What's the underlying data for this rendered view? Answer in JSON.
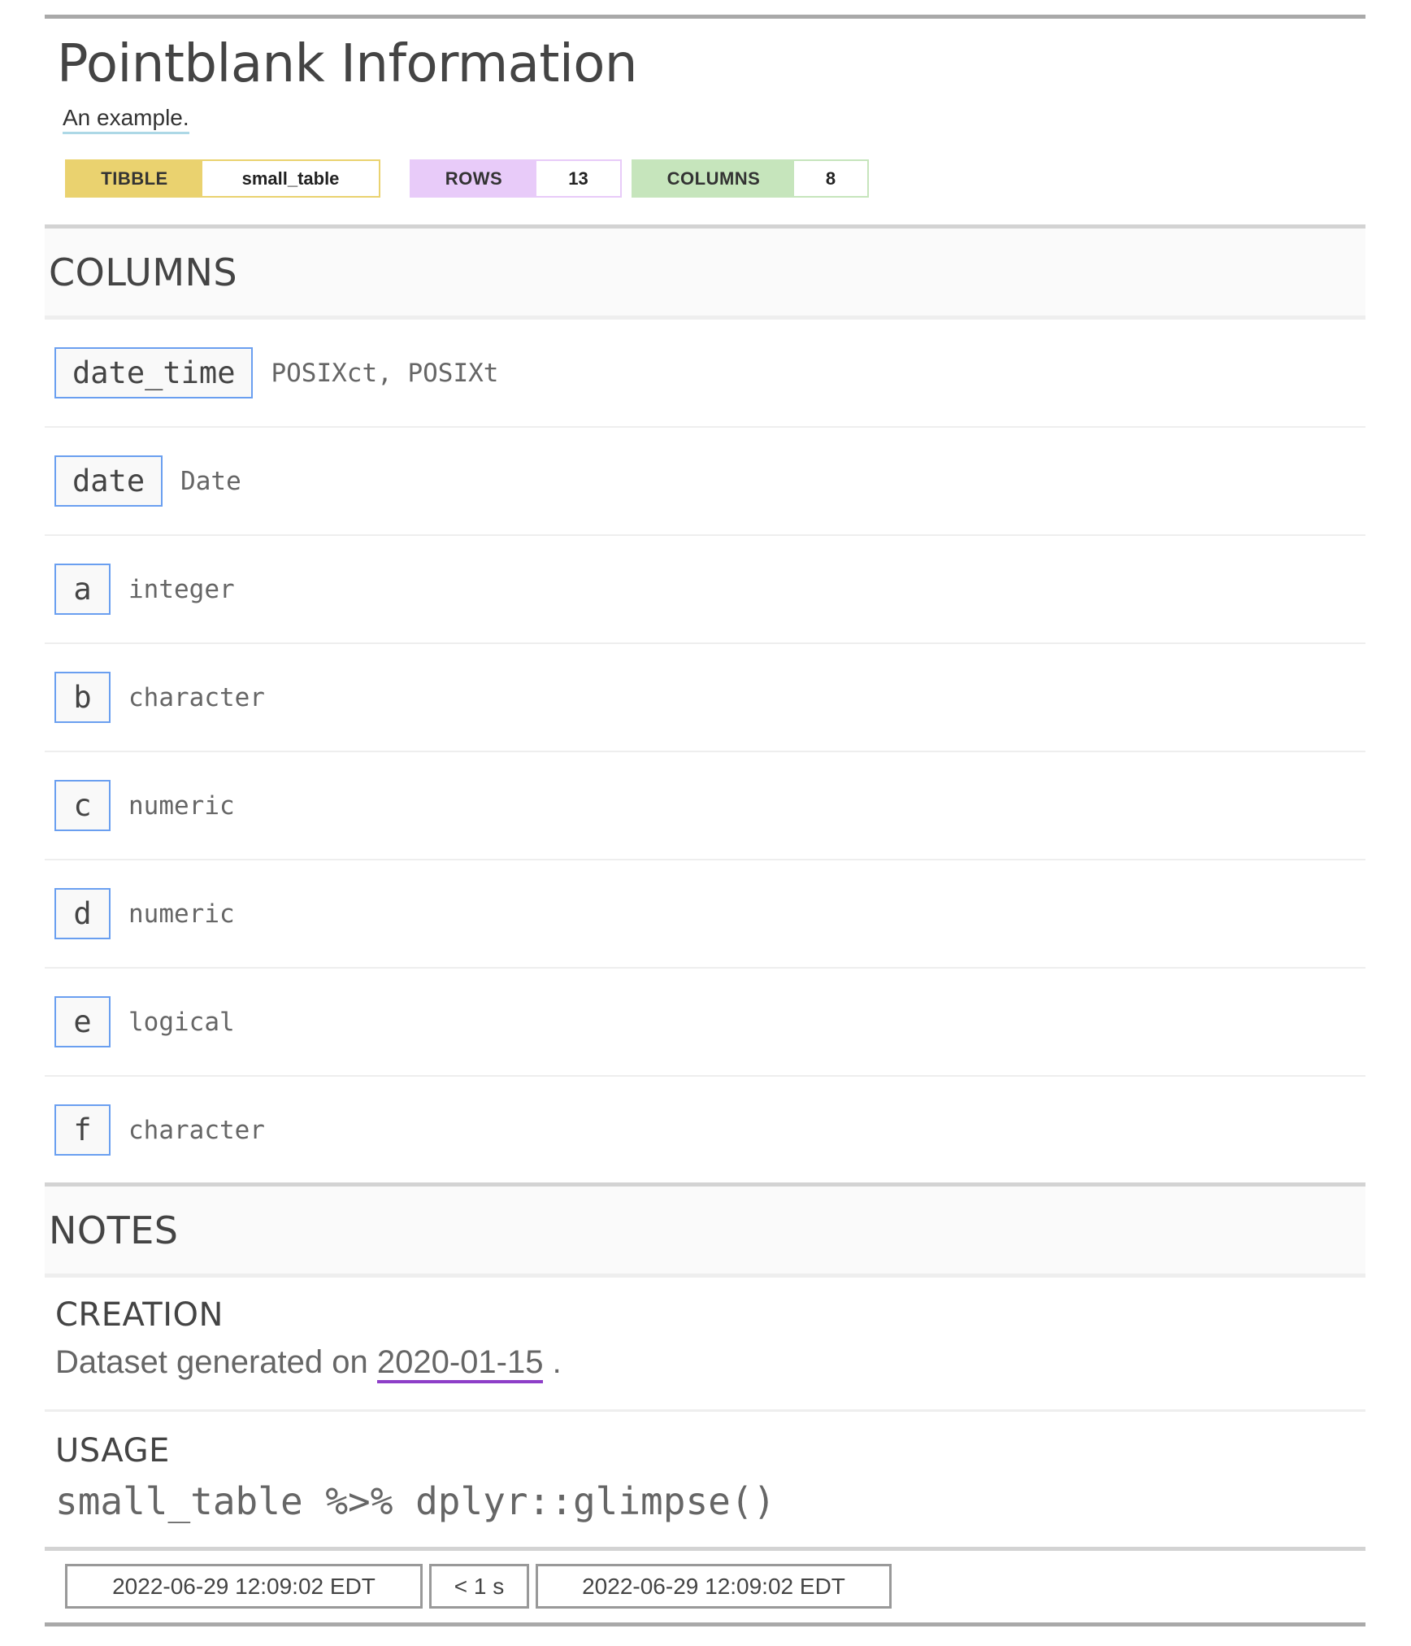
{
  "header": {
    "title": "Pointblank Information",
    "subtitle": "An example."
  },
  "badges": {
    "table_type_label": "TIBBLE",
    "table_name": "small_table",
    "rows_label": "ROWS",
    "rows_value": "13",
    "columns_label": "COLUMNS",
    "columns_value": "8"
  },
  "columns_section": {
    "heading": "COLUMNS",
    "columns": [
      {
        "name": "date_time",
        "type": "POSIXct, POSIXt"
      },
      {
        "name": "date",
        "type": "Date"
      },
      {
        "name": "a",
        "type": "integer"
      },
      {
        "name": "b",
        "type": "character"
      },
      {
        "name": "c",
        "type": "numeric"
      },
      {
        "name": "d",
        "type": "numeric"
      },
      {
        "name": "e",
        "type": "logical"
      },
      {
        "name": "f",
        "type": "character"
      }
    ]
  },
  "notes_section": {
    "heading": "NOTES",
    "creation": {
      "title": "CREATION",
      "text_before": "Dataset generated on ",
      "date": "2020-01-15",
      "text_after": " ."
    },
    "usage": {
      "title": "USAGE",
      "code": "small_table %>% dplyr::glimpse()"
    }
  },
  "footer": {
    "start_time": "2022-06-29 12:09:02 EDT",
    "duration": "< 1 s",
    "end_time": "2022-06-29 12:09:02 EDT"
  },
  "colors": {
    "tibble_badge": "#ead26f",
    "rows_badge": "#e8cbf9",
    "columns_badge": "#c6e5bc",
    "column_name_border": "#6a9ff0",
    "subtitle_underline": "#add8e6",
    "date_underline": "#8e3fc8"
  }
}
